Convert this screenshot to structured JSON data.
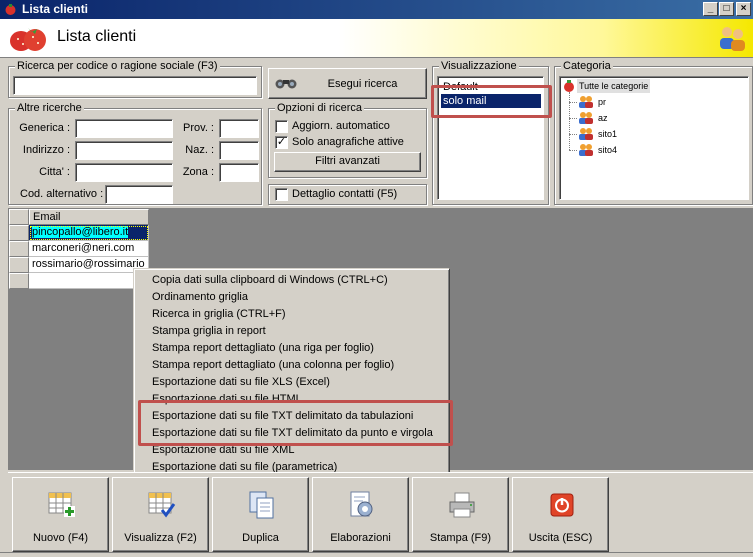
{
  "window": {
    "title": "Lista clienti"
  },
  "header": {
    "title": "Lista clienti"
  },
  "search": {
    "legend": "Ricerca per codice o ragione sociale (F3)",
    "value": "",
    "button_label": "Esegui ricerca"
  },
  "other_search": {
    "legend": "Altre ricerche",
    "fields": {
      "generica": "Generica :",
      "indirizzo": "Indirizzo :",
      "citta": "Citta' :",
      "cod_alt": "Cod. alternativo :",
      "prov": "Prov. :",
      "naz": "Naz. :",
      "zona": "Zona :"
    }
  },
  "options": {
    "legend": "Opzioni di ricerca",
    "auto_update_label": "Aggiorn. automatico",
    "auto_update_checked": false,
    "only_active_label": "Solo anagrafiche attive",
    "only_active_checked": true,
    "advanced_filters_label": "Filtri avanzati",
    "contact_detail_label": "Dettaglio contatti (F5)",
    "contact_detail_checked": false
  },
  "view": {
    "legend": "Visualizzazione",
    "items": [
      "Default",
      "solo mail"
    ],
    "selected": "solo mail"
  },
  "category": {
    "legend": "Categoria",
    "root": "Tutte le categorie",
    "children": [
      "pr",
      "az",
      "sito1",
      "sito4"
    ]
  },
  "grid": {
    "column": "Email",
    "rows": [
      "pincopallo@libero.it",
      "marconeri@neri.com",
      "rossimario@rossimario"
    ]
  },
  "context_menu": {
    "items": [
      "Copia dati sulla clipboard di Windows (CTRL+C)",
      "Ordinamento griglia",
      "Ricerca in griglia (CTRL+F)",
      "Stampa griglia in report",
      "Stampa report dettagliato (una riga per foglio)",
      "Stampa report dettagliato (una colonna per foglio)",
      "Esportazione dati su file XLS (Excel)",
      "Esportazione dati su file HTML",
      "Esportazione dati su file TXT delimitato da tabulazioni",
      "Esportazione dati su file TXT delimitato da punto e virgola",
      "Esportazione dati su file XML",
      "Esportazione dati su file (parametrica)"
    ]
  },
  "toolbar": {
    "new": "Nuovo (F4)",
    "view": "Visualizza (F2)",
    "duplicate": "Duplica",
    "process": "Elaborazioni",
    "print": "Stampa (F9)",
    "exit": "Uscita (ESC)"
  },
  "colors": {
    "selection": "#0a246a",
    "highlight": "#c0504d",
    "face": "#d4d0c8"
  }
}
